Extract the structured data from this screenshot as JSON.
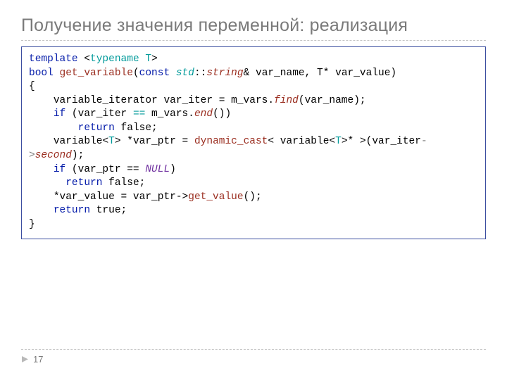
{
  "title": "Получение значения переменной: реализация",
  "page_number": "17",
  "code": {
    "l1": {
      "kw_template": "template",
      "lt": "<",
      "kw_typename": "typename T",
      "gt": ">"
    },
    "l2": {
      "kw_bool": "bool",
      "fn": "get_variable",
      "op1": "(",
      "kw_const": "const",
      "std": "std",
      "cc": "::",
      "string": "string",
      "amp": "& var_name, T* var_value)"
    },
    "l3": "{",
    "l4": {
      "indent": "    ",
      "t1": "variable_iterator var_iter = m_vars.",
      "m": "find",
      "t2": "(var_name);"
    },
    "l5": {
      "indent": "    ",
      "kw_if": "if",
      "t1": " (var_iter ",
      "eq": "==",
      "t2": " m_vars.",
      "m": "end",
      "t3": "())"
    },
    "l6": {
      "indent": "        ",
      "kw_return": "return",
      "t": " false;"
    },
    "l7a": {
      "indent": "    ",
      "t1": "variable",
      "lt1": "<",
      "T1": "T",
      "gt1": ">",
      "t2": " *var_ptr = ",
      "fn": "dynamic_cast",
      "lt2": "<",
      "t3": " variable",
      "lt3": "<",
      "T2": "T",
      "gt3": ">",
      "t4": "* ",
      "gt2": ">",
      "t5": "(var_iter",
      "arr": "->",
      "m": "second",
      "t6": ");"
    },
    "l8": {
      "indent": "    ",
      "kw_if": "if",
      "t1": " (var_ptr == ",
      "null": "NULL",
      "t2": ")"
    },
    "l9": {
      "indent": "      ",
      "kw_return": "return",
      "t": " false;"
    },
    "l10": {
      "indent": "    ",
      "t1": "*var_value = var_ptr",
      "arr": "->",
      "fn": "get_value",
      "t2": "();"
    },
    "l11": {
      "indent": "    ",
      "kw_return": "return",
      "t": " true;"
    },
    "l12": "}"
  }
}
